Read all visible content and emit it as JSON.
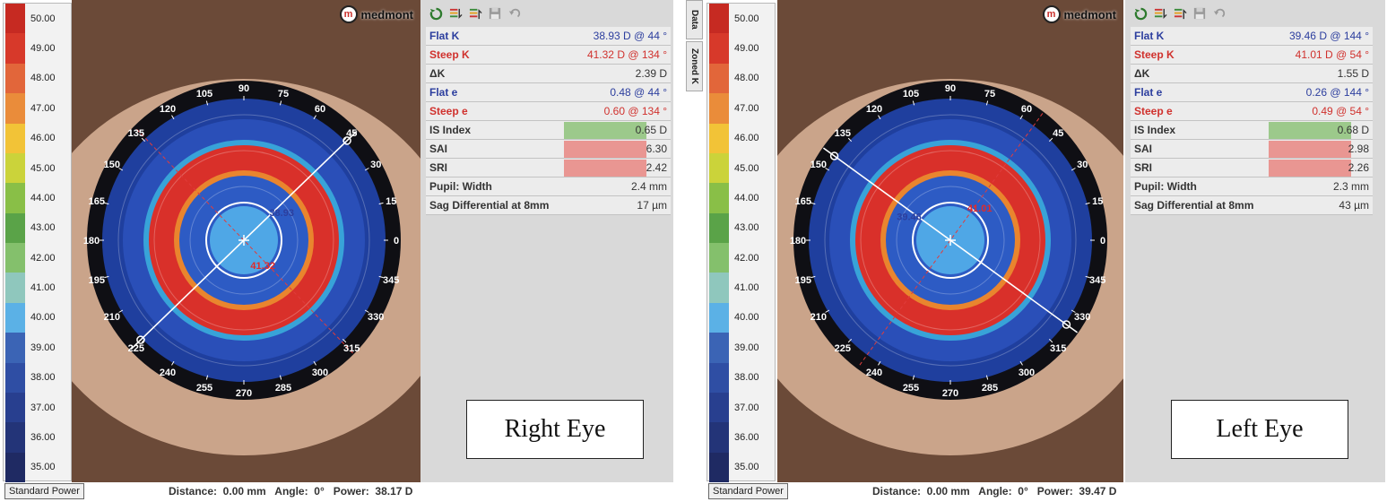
{
  "scale": {
    "values": [
      "50.00",
      "49.00",
      "48.00",
      "47.00",
      "46.00",
      "45.00",
      "44.00",
      "43.00",
      "42.00",
      "41.00",
      "40.00",
      "39.00",
      "38.00",
      "37.00",
      "36.00",
      "35.00"
    ],
    "colors": [
      "#c62a22",
      "#d7392a",
      "#e2663a",
      "#ea8c3a",
      "#f2c337",
      "#cbd33a",
      "#89bf47",
      "#5aa348",
      "#84c06c",
      "#8fc7bd",
      "#5bb1e6",
      "#3b64b5",
      "#2f4ea4",
      "#283f8f",
      "#233478",
      "#1f2a63"
    ]
  },
  "brand": {
    "mark": "m",
    "name": "medmont"
  },
  "angle_labels": [
    "0",
    "15",
    "30",
    "45",
    "60",
    "75",
    "90",
    "105",
    "120",
    "135",
    "150",
    "165",
    "180",
    "195",
    "210",
    "225",
    "240",
    "255",
    "270",
    "285",
    "300",
    "315",
    "330",
    "345"
  ],
  "right": {
    "apex_labels": {
      "steep": "41.32",
      "flat": "38.93"
    },
    "rows": [
      {
        "label": "Flat K",
        "value": "38.93 D @  44 °",
        "kind": "flat"
      },
      {
        "label": "Steep K",
        "value": "41.32 D @ 134 °",
        "kind": "steep"
      },
      {
        "label": "ΔK",
        "value": "2.39 D",
        "kind": ""
      },
      {
        "label": "Flat e",
        "value": "0.48 @  44 °",
        "kind": "flat"
      },
      {
        "label": "Steep e",
        "value": "0.60 @ 134 °",
        "kind": "steep"
      },
      {
        "label": "IS Index",
        "value": "0.65 D",
        "kind": "",
        "hl": "green"
      },
      {
        "label": "SAI",
        "value": "6.30",
        "kind": "",
        "hl": "red"
      },
      {
        "label": "SRI",
        "value": "2.42",
        "kind": "",
        "hl": "red"
      },
      {
        "label": "Pupil: Width",
        "value": "2.4 mm",
        "kind": ""
      },
      {
        "label": "Sag Differential at 8mm",
        "value": "17 µm",
        "kind": ""
      }
    ],
    "eye_label": "Right Eye",
    "status": {
      "mode": "Standard Power",
      "text": "Distance:  0.00 mm   Angle:  0°   Power:  38.17 D"
    }
  },
  "left": {
    "apex_labels": {
      "steep": "41.01",
      "flat": "39.46"
    },
    "rows": [
      {
        "label": "Flat K",
        "value": "39.46 D @ 144 °",
        "kind": "flat"
      },
      {
        "label": "Steep K",
        "value": "41.01 D @  54 °",
        "kind": "steep"
      },
      {
        "label": "ΔK",
        "value": "1.55 D",
        "kind": ""
      },
      {
        "label": "Flat e",
        "value": "0.26 @ 144 °",
        "kind": "flat"
      },
      {
        "label": "Steep e",
        "value": "0.49 @  54 °",
        "kind": "steep"
      },
      {
        "label": "IS Index",
        "value": "0.68 D",
        "kind": "",
        "hl": "green"
      },
      {
        "label": "SAI",
        "value": "2.98",
        "kind": "",
        "hl": "red"
      },
      {
        "label": "SRI",
        "value": "2.26",
        "kind": "",
        "hl": "red"
      },
      {
        "label": "Pupil: Width",
        "value": "2.3 mm",
        "kind": ""
      },
      {
        "label": "Sag Differential at 8mm",
        "value": "43 µm",
        "kind": ""
      }
    ],
    "eye_label": "Left Eye",
    "status": {
      "mode": "Standard Power",
      "text": "Distance:  0.00 mm   Angle:  0°   Power:  39.47 D"
    }
  },
  "tabs": {
    "data": "Data",
    "zoned": "Zoned K"
  }
}
